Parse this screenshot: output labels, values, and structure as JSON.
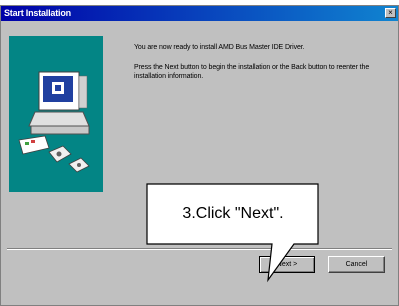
{
  "window": {
    "title": "Start Installation",
    "close_label": "×"
  },
  "content": {
    "message1": "You are now ready to install AMD Bus Master IDE Driver.",
    "message2": "Press the Next button to begin the installation or the Back button to reenter the installation information."
  },
  "buttons": {
    "next_label": "Next >",
    "cancel_label": "Cancel"
  },
  "callout": {
    "text": "3.Click \"Next\"."
  }
}
